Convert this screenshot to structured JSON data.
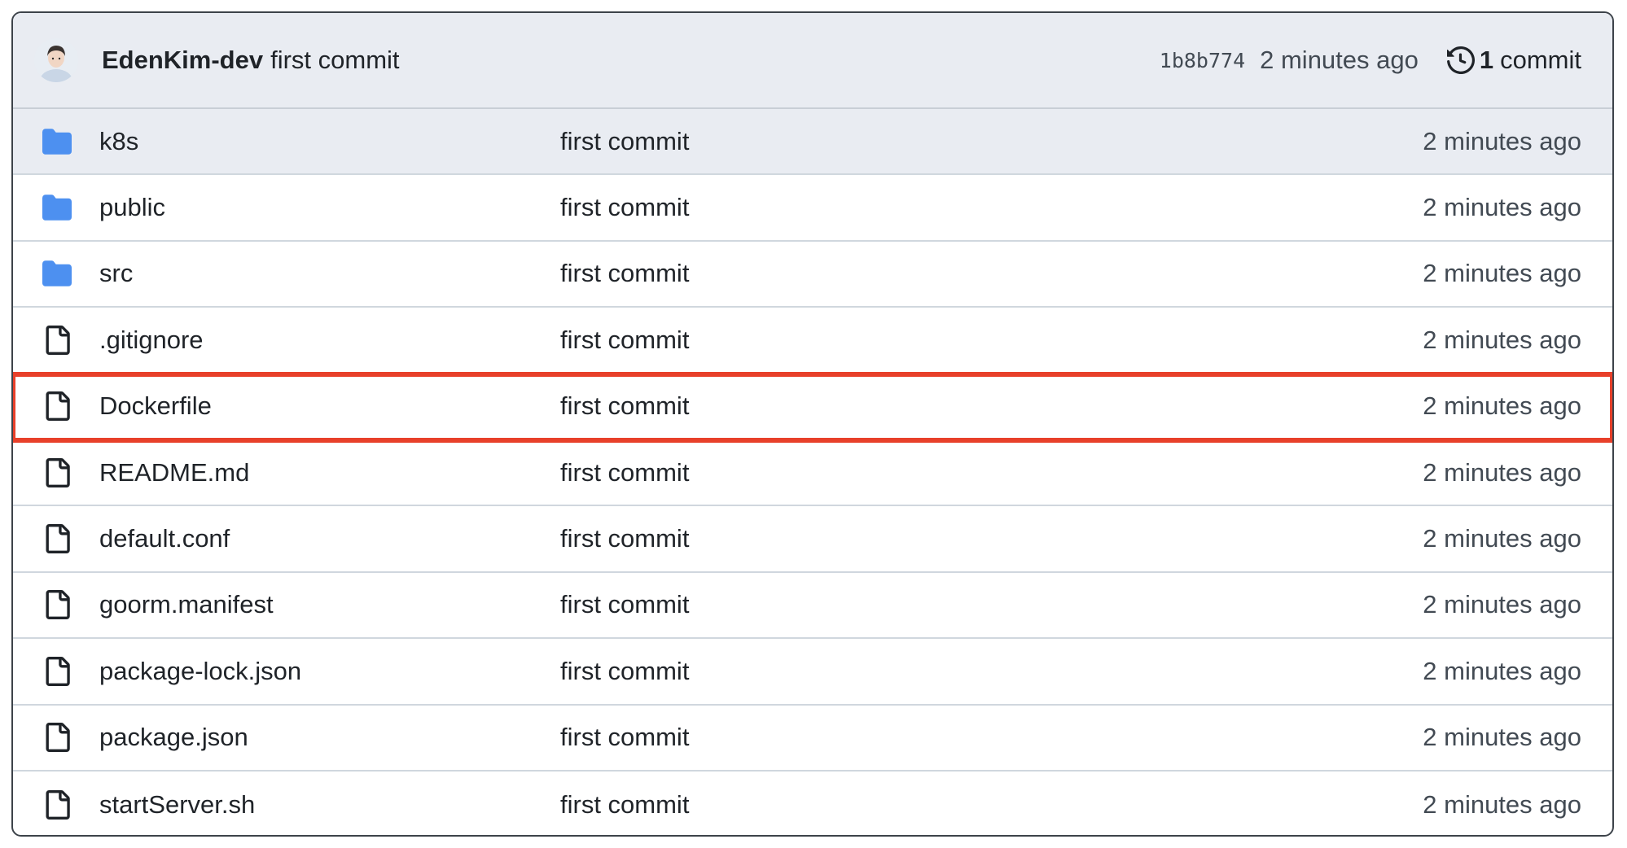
{
  "header": {
    "author": "EdenKim-dev",
    "message": "first commit",
    "sha": "1b8b774",
    "time": "2 minutes ago",
    "commit_count": "1",
    "commit_label": "commit",
    "avatar_icon": "user-avatar",
    "history_icon": "history-icon"
  },
  "colors": {
    "folder": "#54aeff",
    "highlight": "#e8402a",
    "header_bg": "#e9ecf2"
  },
  "files": [
    {
      "name": "k8s",
      "type": "folder",
      "commit": "first commit",
      "time": "2 minutes ago"
    },
    {
      "name": "public",
      "type": "folder",
      "commit": "first commit",
      "time": "2 minutes ago"
    },
    {
      "name": "src",
      "type": "folder",
      "commit": "first commit",
      "time": "2 minutes ago"
    },
    {
      "name": ".gitignore",
      "type": "file",
      "commit": "first commit",
      "time": "2 minutes ago"
    },
    {
      "name": "Dockerfile",
      "type": "file",
      "commit": "first commit",
      "time": "2 minutes ago"
    },
    {
      "name": "README.md",
      "type": "file",
      "commit": "first commit",
      "time": "2 minutes ago"
    },
    {
      "name": "default.conf",
      "type": "file",
      "commit": "first commit",
      "time": "2 minutes ago"
    },
    {
      "name": "goorm.manifest",
      "type": "file",
      "commit": "first commit",
      "time": "2 minutes ago"
    },
    {
      "name": "package-lock.json",
      "type": "file",
      "commit": "first commit",
      "time": "2 minutes ago"
    },
    {
      "name": "package.json",
      "type": "file",
      "commit": "first commit",
      "time": "2 minutes ago"
    },
    {
      "name": "startServer.sh",
      "type": "file",
      "commit": "first commit",
      "time": "2 minutes ago"
    }
  ]
}
